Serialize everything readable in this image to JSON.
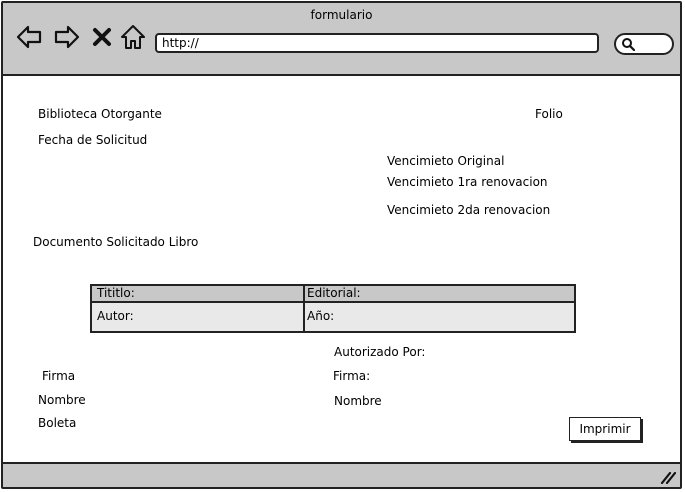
{
  "window": {
    "title": "formulario"
  },
  "toolbar": {
    "back_icon": "arrow-left-icon",
    "forward_icon": "arrow-right-icon",
    "stop_icon": "close-icon",
    "home_icon": "home-icon",
    "search_icon": "search-icon"
  },
  "address_bar": {
    "value": "http://"
  },
  "form": {
    "biblioteca_label": "Biblioteca Otorgante",
    "folio_label": "Folio",
    "fecha_label": "Fecha de Solicitud",
    "venc_original_label": "Vencimieto Original",
    "venc_1ra_label": "Vencimieto 1ra renovacion",
    "venc_2da_label": "Vencimieto 2da renovacion",
    "documento_label": "Documento Solicitado Libro",
    "book_table": {
      "rows": [
        [
          "Tititlo:",
          "Editorial:"
        ],
        [
          "Autor:",
          "Año:"
        ]
      ]
    },
    "autorizado_label": "Autorizado Por:",
    "left_firma_label": "Firma",
    "left_nombre_label": "Nombre",
    "boleta_label": "Boleta",
    "right_firma_label": "Firma:",
    "right_nombre_label": "Nombre",
    "print_button": "Imprimir"
  },
  "statusbar": {
    "grip_icon": "resize-grip-icon"
  },
  "colors": {
    "chrome": "#c8c8c8",
    "table_body": "#e9e9e9",
    "stroke": "#222222"
  }
}
